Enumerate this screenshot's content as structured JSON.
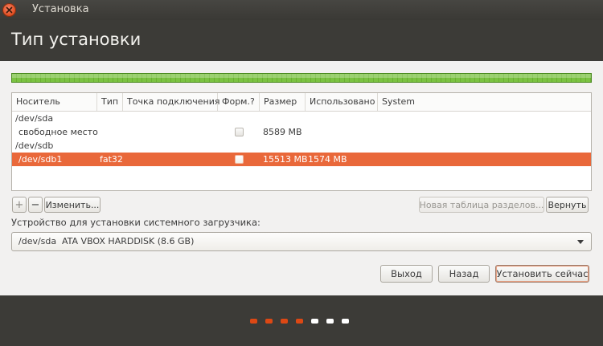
{
  "window": {
    "title": "Установка"
  },
  "header": {
    "title": "Тип установки"
  },
  "progress": {
    "percent": 100
  },
  "table": {
    "columns": [
      "Носитель",
      "Тип",
      "Точка подключения",
      "Форм.?",
      "Размер",
      "Использовано",
      "System"
    ],
    "rows": [
      {
        "device": "/dev/sda",
        "type": "",
        "mount": "",
        "format": null,
        "size": "",
        "used": "",
        "system": ""
      },
      {
        "device": "свободное место",
        "type": "",
        "mount": "",
        "format": false,
        "size": "8589 MB",
        "used": "",
        "system": ""
      },
      {
        "device": "/dev/sdb",
        "type": "",
        "mount": "",
        "format": null,
        "size": "",
        "used": "",
        "system": ""
      },
      {
        "device": "/dev/sdb1",
        "type": "fat32",
        "mount": "",
        "format": false,
        "size": "15513 MB",
        "used": "1574 MB",
        "system": "",
        "selected": true
      }
    ]
  },
  "partition_tools": {
    "add_label": "+",
    "remove_label": "−",
    "change_label": "Изменить...",
    "new_table_label": "Новая таблица разделов...",
    "revert_label": "Вернуть"
  },
  "bootloader": {
    "label": "Устройство для установки системного загрузчика:",
    "device": "/dev/sda",
    "description": "ATA VBOX HARDDISK (8.6 GB)"
  },
  "actions": {
    "quit_label": "Выход",
    "back_label": "Назад",
    "install_label": "Установить сейчас"
  },
  "steps": {
    "total": 7,
    "completed": 4
  },
  "colors": {
    "accent": "#e9683a",
    "progress": "#7bc242",
    "step_done": "#dd4814",
    "step_todo": "#ffffff"
  }
}
